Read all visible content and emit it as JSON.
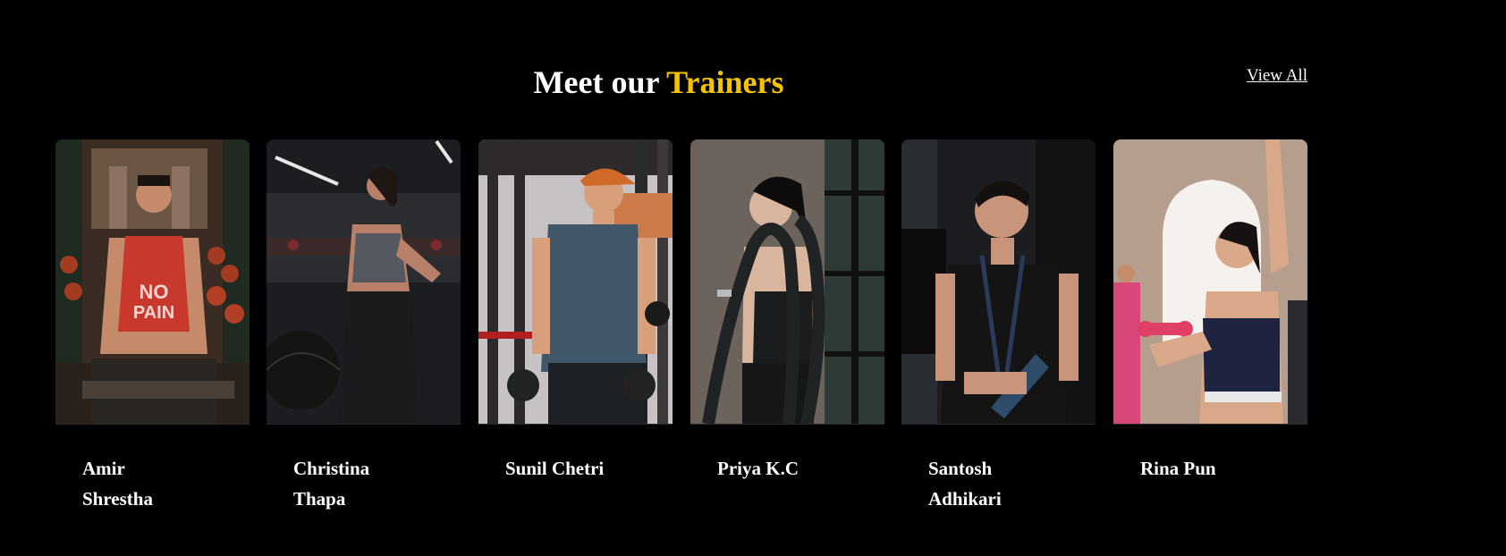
{
  "section": {
    "title_prefix": "Meet our ",
    "title_accent": "Trainers",
    "view_all_label": "View All",
    "accent_color": "#f5c300"
  },
  "trainers": [
    {
      "name": "Amir Shrestha",
      "photo": "trainer-photo-man-red-tank-dumbbells"
    },
    {
      "name": "Christina Thapa",
      "photo": "trainer-photo-woman-medicine-ball"
    },
    {
      "name": "Sunil Chetri",
      "photo": "trainer-photo-man-orange-cap"
    },
    {
      "name": "Priya K.C",
      "photo": "trainer-photo-woman-battle-rope"
    },
    {
      "name": "Santosh Adhikari",
      "photo": "trainer-photo-man-smiling-bottle"
    },
    {
      "name": "Rina Pun",
      "photo": "trainer-photo-woman-pink-dumbbell"
    }
  ]
}
